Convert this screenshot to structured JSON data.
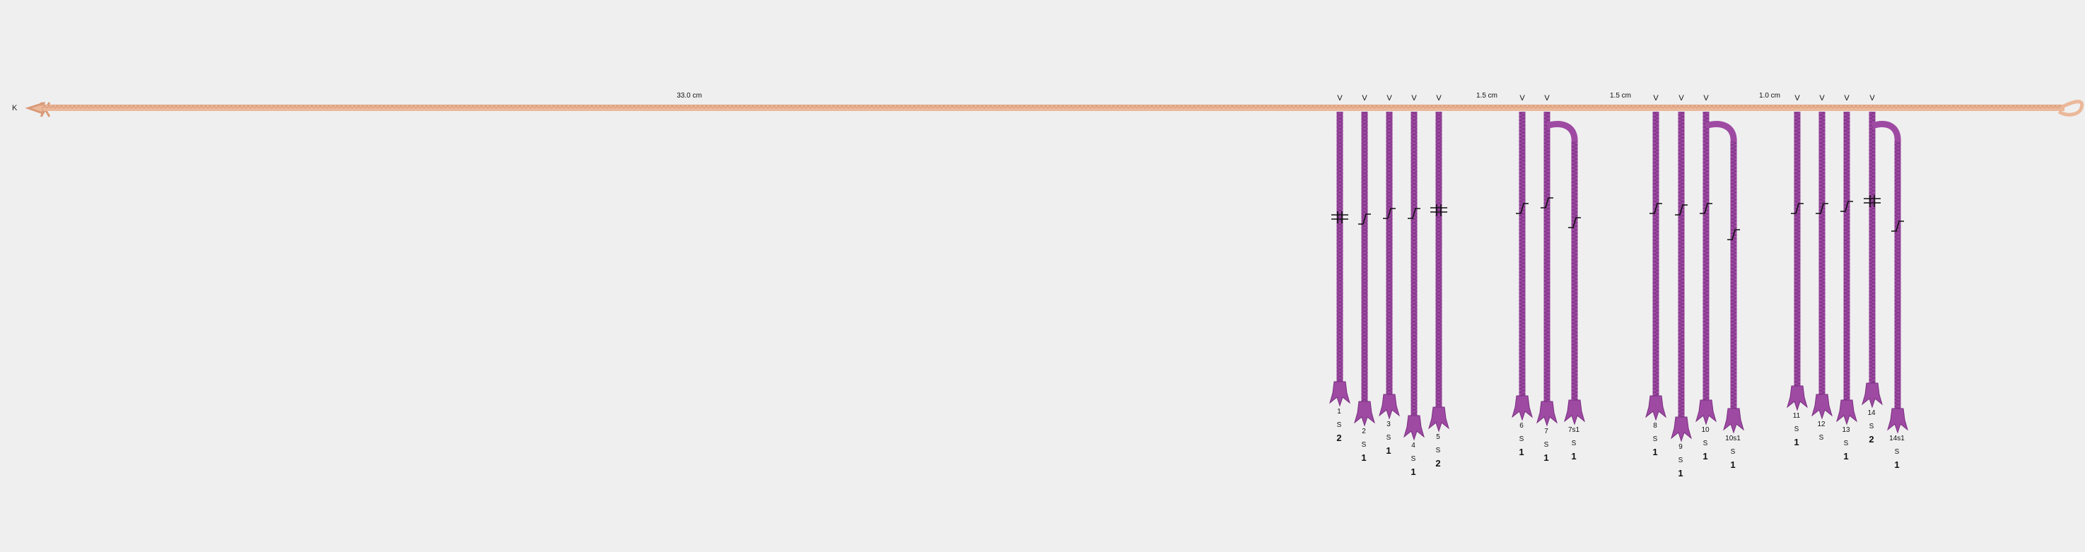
{
  "colors": {
    "background": "#efefef",
    "main_cord": "#ebb89a",
    "main_cord_dark": "#d99a78",
    "pendant": "#9e4aa3",
    "pendant_dark": "#7a2f80",
    "ink": "#111111"
  },
  "main_cord": {
    "start_label": "K",
    "length_label": "33.0 cm"
  },
  "spacings": [
    {
      "label": "1.5 cm"
    },
    {
      "label": "1.5 cm"
    },
    {
      "label": "1.0 cm"
    }
  ],
  "cords": [
    {
      "id": "1",
      "attach": "V",
      "ply": "S",
      "value": "2",
      "knot": "long",
      "subsidiary": false
    },
    {
      "id": "2",
      "attach": "V",
      "ply": "S",
      "value": "1",
      "knot": "single",
      "subsidiary": false
    },
    {
      "id": "3",
      "attach": "V",
      "ply": "S",
      "value": "1",
      "knot": "single",
      "subsidiary": false
    },
    {
      "id": "4",
      "attach": "V",
      "ply": "S",
      "value": "1",
      "knot": "single",
      "subsidiary": false
    },
    {
      "id": "5",
      "attach": "V",
      "ply": "S",
      "value": "2",
      "knot": "long",
      "subsidiary": false
    },
    {
      "id": "6",
      "attach": "V",
      "ply": "S",
      "value": "1",
      "knot": "single",
      "subsidiary": false
    },
    {
      "id": "7",
      "attach": "V",
      "ply": "S",
      "value": "1",
      "knot": "single",
      "subsidiary": false
    },
    {
      "id": "7s1",
      "attach": "",
      "ply": "S",
      "value": "1",
      "knot": "single",
      "subsidiary": true
    },
    {
      "id": "8",
      "attach": "V",
      "ply": "S",
      "value": "1",
      "knot": "single",
      "subsidiary": false
    },
    {
      "id": "9",
      "attach": "V",
      "ply": "S",
      "value": "1",
      "knot": "single",
      "subsidiary": false
    },
    {
      "id": "10",
      "attach": "V",
      "ply": "S",
      "value": "1",
      "knot": "single",
      "subsidiary": false
    },
    {
      "id": "10s1",
      "attach": "",
      "ply": "S",
      "value": "1",
      "knot": "single",
      "subsidiary": true
    },
    {
      "id": "11",
      "attach": "V",
      "ply": "S",
      "value": "1",
      "knot": "single",
      "subsidiary": false
    },
    {
      "id": "12",
      "attach": "V",
      "ply": "S",
      "value": "",
      "knot": "single",
      "subsidiary": false
    },
    {
      "id": "13",
      "attach": "V",
      "ply": "S",
      "value": "1",
      "knot": "single",
      "subsidiary": false
    },
    {
      "id": "14",
      "attach": "V",
      "ply": "S",
      "value": "2",
      "knot": "long",
      "subsidiary": false
    },
    {
      "id": "14s1",
      "attach": "",
      "ply": "S",
      "value": "1",
      "knot": "single",
      "subsidiary": true
    }
  ]
}
